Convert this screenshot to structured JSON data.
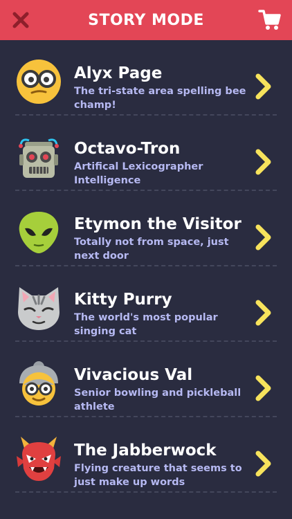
{
  "header": {
    "title": "STORY MODE",
    "close_icon": "close-x-icon",
    "cart_icon": "shopping-cart-icon"
  },
  "colors": {
    "header_bg": "#e34656",
    "page_bg": "#2a2c40",
    "name_text": "#ffffff",
    "desc_text": "#b6b9f2",
    "chevron": "#f7e35c"
  },
  "characters": [
    {
      "name": "Alyx Page",
      "description": "The tri-state area spelling bee champ!",
      "icon": "nerd-face-icon"
    },
    {
      "name": "Octavo-Tron",
      "description": "Artifical Lexicographer Intelligence",
      "icon": "robot-icon"
    },
    {
      "name": "Etymon the Visitor",
      "description": "Totally not from space, just next door",
      "icon": "alien-icon"
    },
    {
      "name": "Kitty Purry",
      "description": "The world's most popular singing cat",
      "icon": "cat-face-icon"
    },
    {
      "name": "Vivacious Val",
      "description": "Senior bowling and pickleball athlete",
      "icon": "grandma-icon"
    },
    {
      "name": "The Jabberwock",
      "description": "Flying creature that seems to just make up words",
      "icon": "red-monster-icon"
    }
  ]
}
